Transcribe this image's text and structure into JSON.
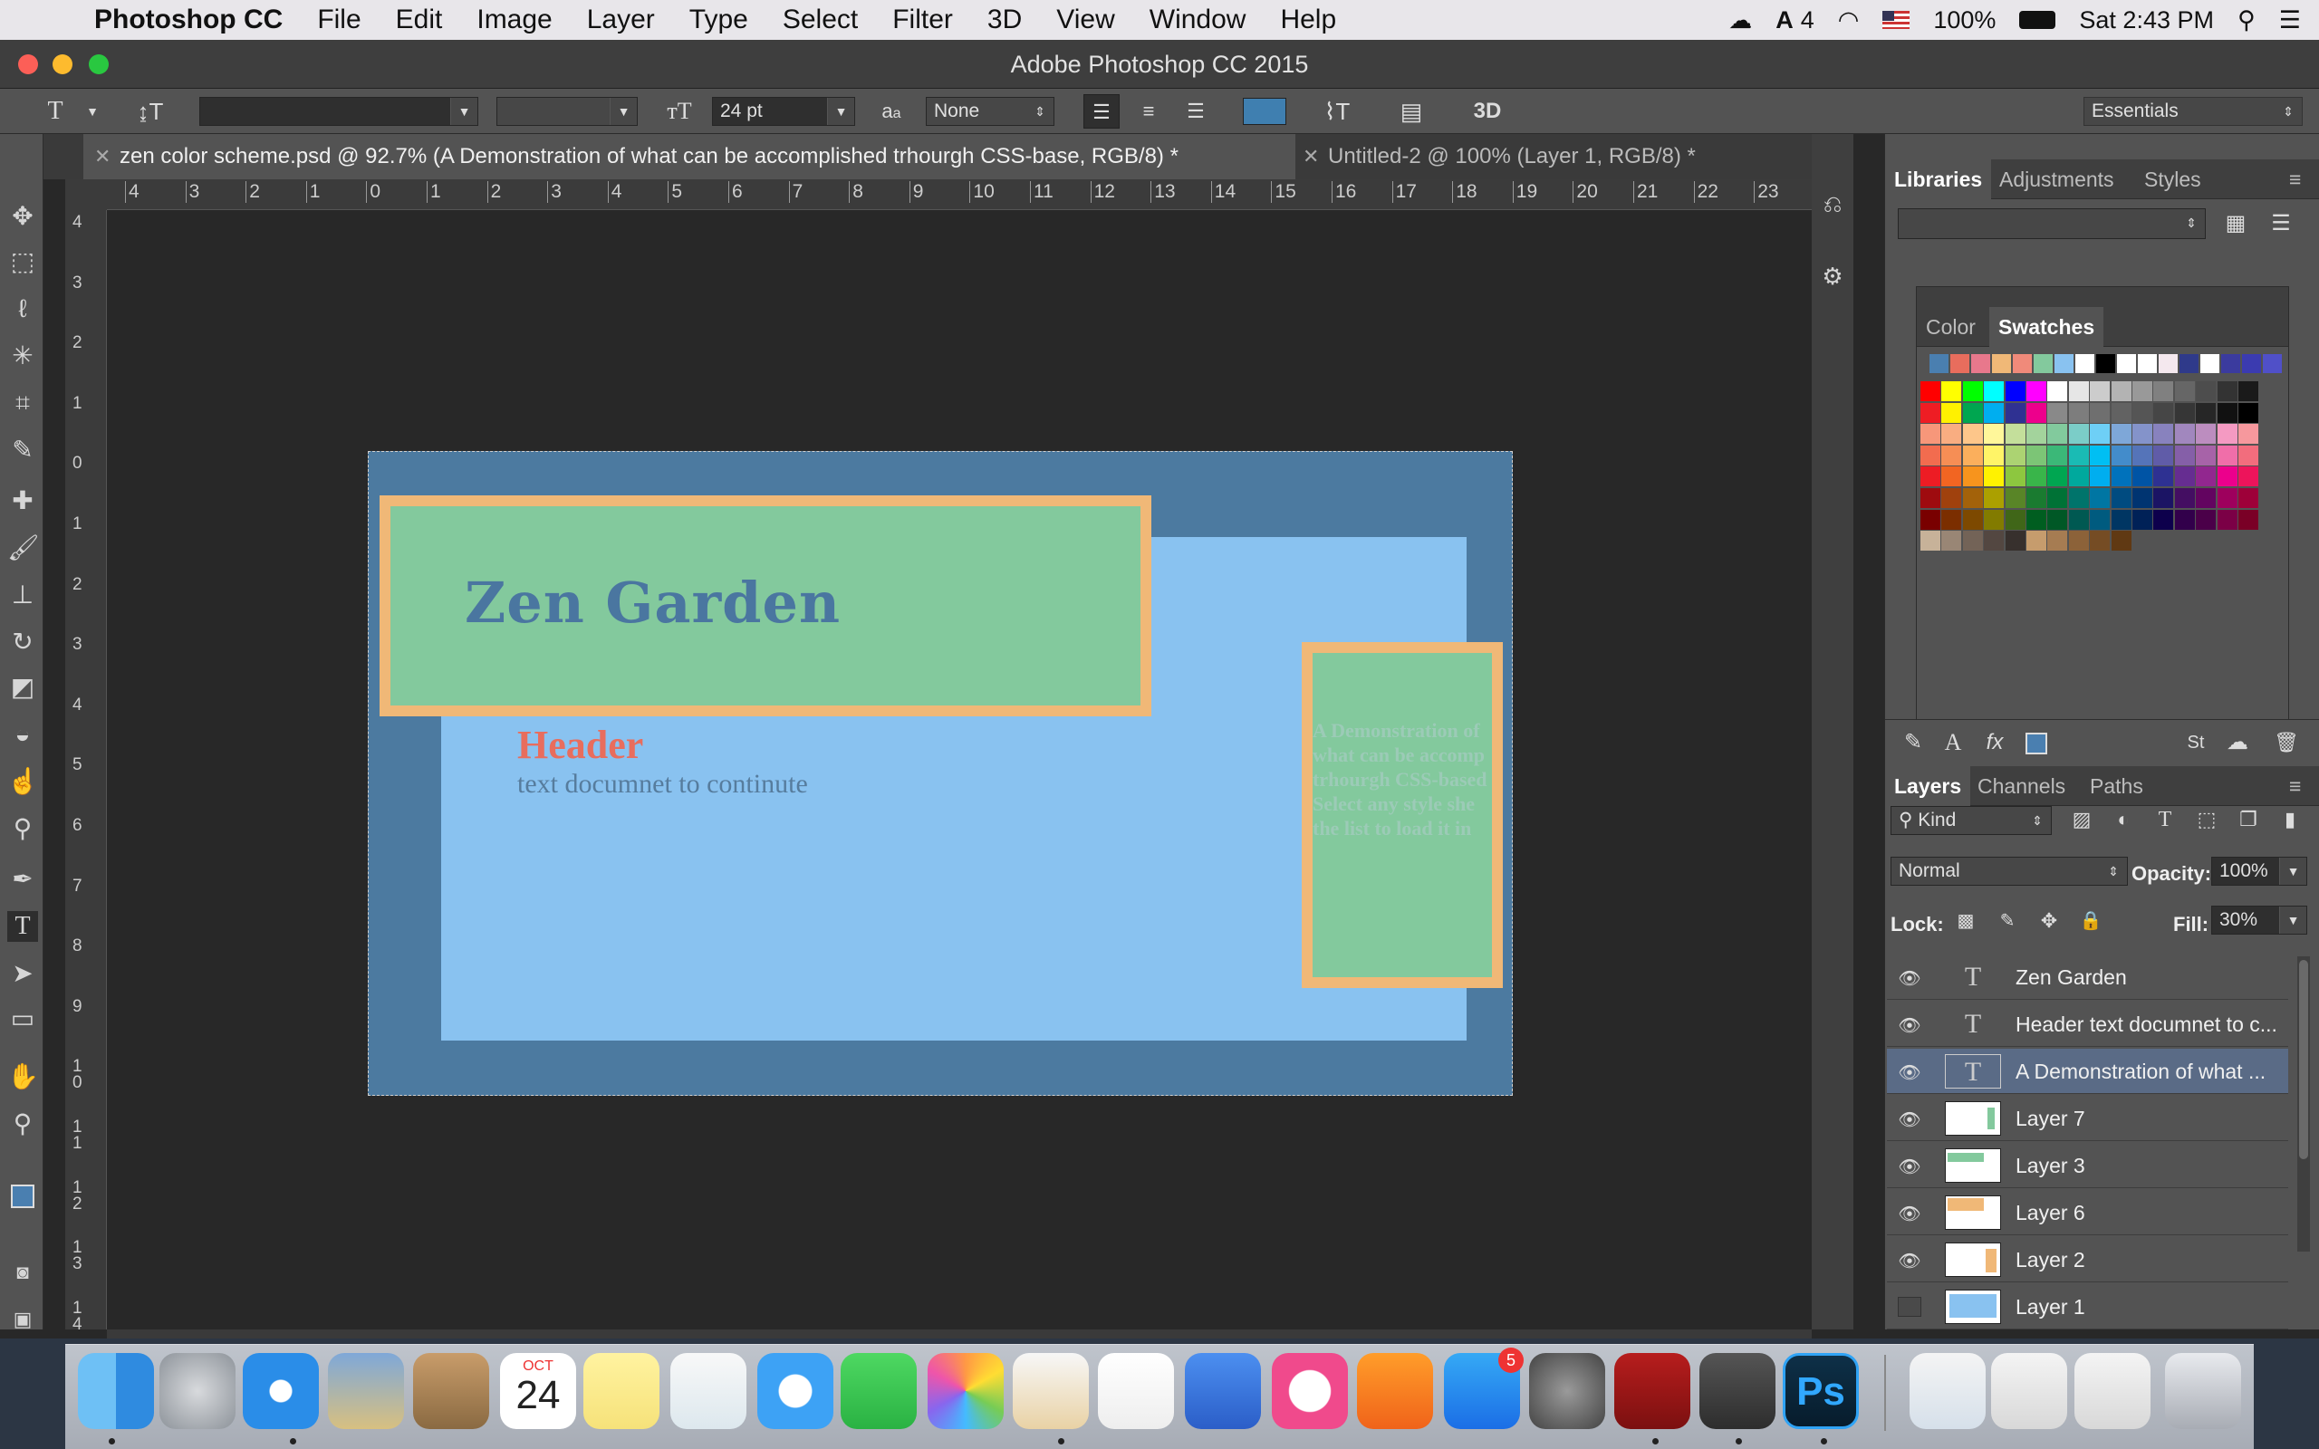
{
  "menubar": {
    "app_name": "Photoshop CC",
    "menus": [
      "File",
      "Edit",
      "Image",
      "Layer",
      "Type",
      "Select",
      "Filter",
      "3D",
      "View",
      "Window",
      "Help"
    ],
    "status": {
      "adobe_count": "4",
      "battery": "100%",
      "clock": "Sat 2:43 PM"
    }
  },
  "window": {
    "title": "Adobe Photoshop CC 2015"
  },
  "options_bar": {
    "font_size": "24 pt",
    "aa_label": "a",
    "aa_sub": "a",
    "antialias": "None",
    "warp_label": "3D",
    "workspace": "Essentials",
    "text_color": "#3f7fb0"
  },
  "doc_tabs": [
    {
      "label": "zen color scheme.psd @ 92.7% (A Demonstration of  what can be accomplished  trhourgh CSS-base, RGB/8) *",
      "active": true
    },
    {
      "label": "Untitled-2 @ 100% (Layer 1, RGB/8) *",
      "active": false
    }
  ],
  "rulers": {
    "h_ticks": [
      "4",
      "3",
      "2",
      "1",
      "0",
      "1",
      "2",
      "3",
      "4",
      "5",
      "6",
      "7",
      "8",
      "9",
      "10",
      "11",
      "12",
      "13",
      "14",
      "15",
      "16",
      "17",
      "18",
      "19",
      "20",
      "21",
      "22",
      "23"
    ],
    "v_ticks": [
      "4",
      "3",
      "2",
      "1",
      "0",
      "1",
      "2",
      "3",
      "4",
      "5",
      "6",
      "7",
      "8",
      "9",
      "1\n0",
      "1\n1",
      "1\n2",
      "1\n3",
      "1\n4"
    ]
  },
  "artwork": {
    "title": "Zen Garden",
    "header": "Header",
    "subtext": "text documnet to continute",
    "side_text": [
      "A Demonstration of",
      "what can be accomp",
      "trhourgh CSS-based",
      "Select any style she",
      "the list to load it in"
    ],
    "colors": {
      "dark_blue": "#4c7aa0",
      "light_blue": "#89c2f0",
      "green": "#83c99d",
      "orange": "#f0b877",
      "header_red": "#e86d5d",
      "title_blue": "#4a76a0",
      "sub_gray": "#567c9d"
    }
  },
  "libraries_panel": {
    "tabs": [
      "Libraries",
      "Adjustments",
      "Styles"
    ]
  },
  "swatches_panel": {
    "tabs": [
      "Color",
      "Swatches"
    ]
  },
  "layers_panel": {
    "tabs": [
      "Layers",
      "Channels",
      "Paths"
    ],
    "filter_kind": "Kind",
    "blend_mode": "Normal",
    "opacity_label": "Opacity:",
    "opacity": "100%",
    "lock_label": "Lock:",
    "fill_label": "Fill:",
    "fill": "30%",
    "layers": [
      {
        "name": "Zen Garden",
        "type": "text",
        "visible": true,
        "selected": false
      },
      {
        "name": "Header text documnet to c...",
        "type": "text",
        "visible": true,
        "selected": false
      },
      {
        "name": "A Demonstration of  what ...",
        "type": "text",
        "visible": true,
        "selected": true
      },
      {
        "name": "Layer 7",
        "type": "pixel",
        "visible": true,
        "selected": false,
        "thumb": "#83c99d"
      },
      {
        "name": "Layer 3",
        "type": "pixel",
        "visible": true,
        "selected": false,
        "thumb": "#83c99d"
      },
      {
        "name": "Layer 6",
        "type": "pixel",
        "visible": true,
        "selected": false,
        "thumb": "#f0b877"
      },
      {
        "name": "Layer 2",
        "type": "pixel",
        "visible": true,
        "selected": false,
        "thumb": "#f0b877"
      },
      {
        "name": "Layer 1",
        "type": "pixel",
        "visible": false,
        "selected": false,
        "thumb": "#89c2f0"
      }
    ]
  },
  "dock": {
    "apps": [
      "Finder",
      "Launchpad",
      "Safari",
      "Mail",
      "Contacts",
      "Calendar",
      "Notes",
      "Reminders",
      "Messages",
      "FaceTime",
      "Photos",
      "Pages",
      "Numbers",
      "Keynote",
      "iTunes",
      "iBooks",
      "App Store",
      "System Preferences",
      "Acrobat",
      "Sublime Text",
      "Photoshop",
      "Document",
      "Preview",
      "Preview 2",
      "Trash"
    ],
    "calendar_month": "OCT",
    "calendar_day": "24",
    "app_store_badge": "5",
    "ps_label": "Ps"
  }
}
